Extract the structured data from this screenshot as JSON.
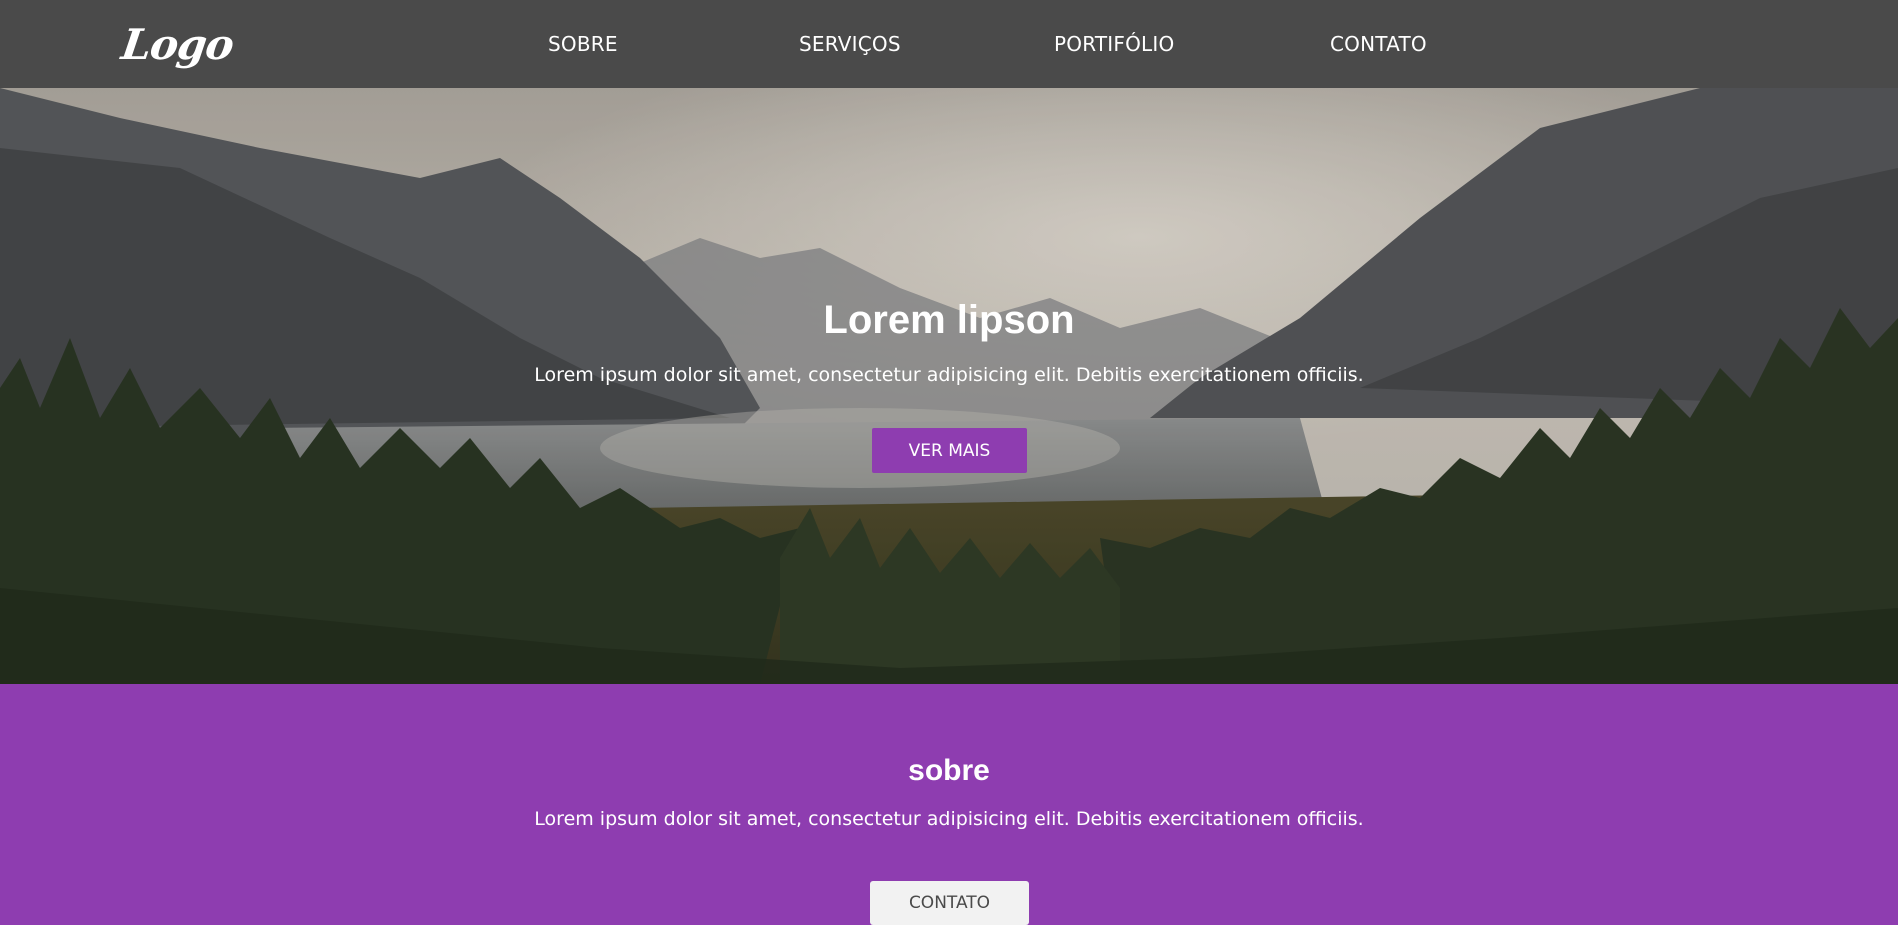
{
  "header": {
    "logo": "Logo",
    "nav": [
      {
        "label": "SOBRE"
      },
      {
        "label": "SERVIÇOS"
      },
      {
        "label": "PORTIFÓLIO"
      },
      {
        "label": "CONTATO"
      }
    ]
  },
  "hero": {
    "title": "Lorem lipson",
    "text": "Lorem ipsum dolor sit amet, consectetur adipisicing elit. Debitis exercitationem officiis.",
    "button_label": "VER MAIS"
  },
  "about": {
    "title": "sobre",
    "text": "Lorem ipsum dolor sit amet, consectetur adipisicing elit. Debitis exercitationem officiis.",
    "button_label": "CONTATO"
  },
  "colors": {
    "header_bg": "#4a4a4a",
    "accent": "#8e3db0",
    "light_button": "#f2f2f2"
  }
}
